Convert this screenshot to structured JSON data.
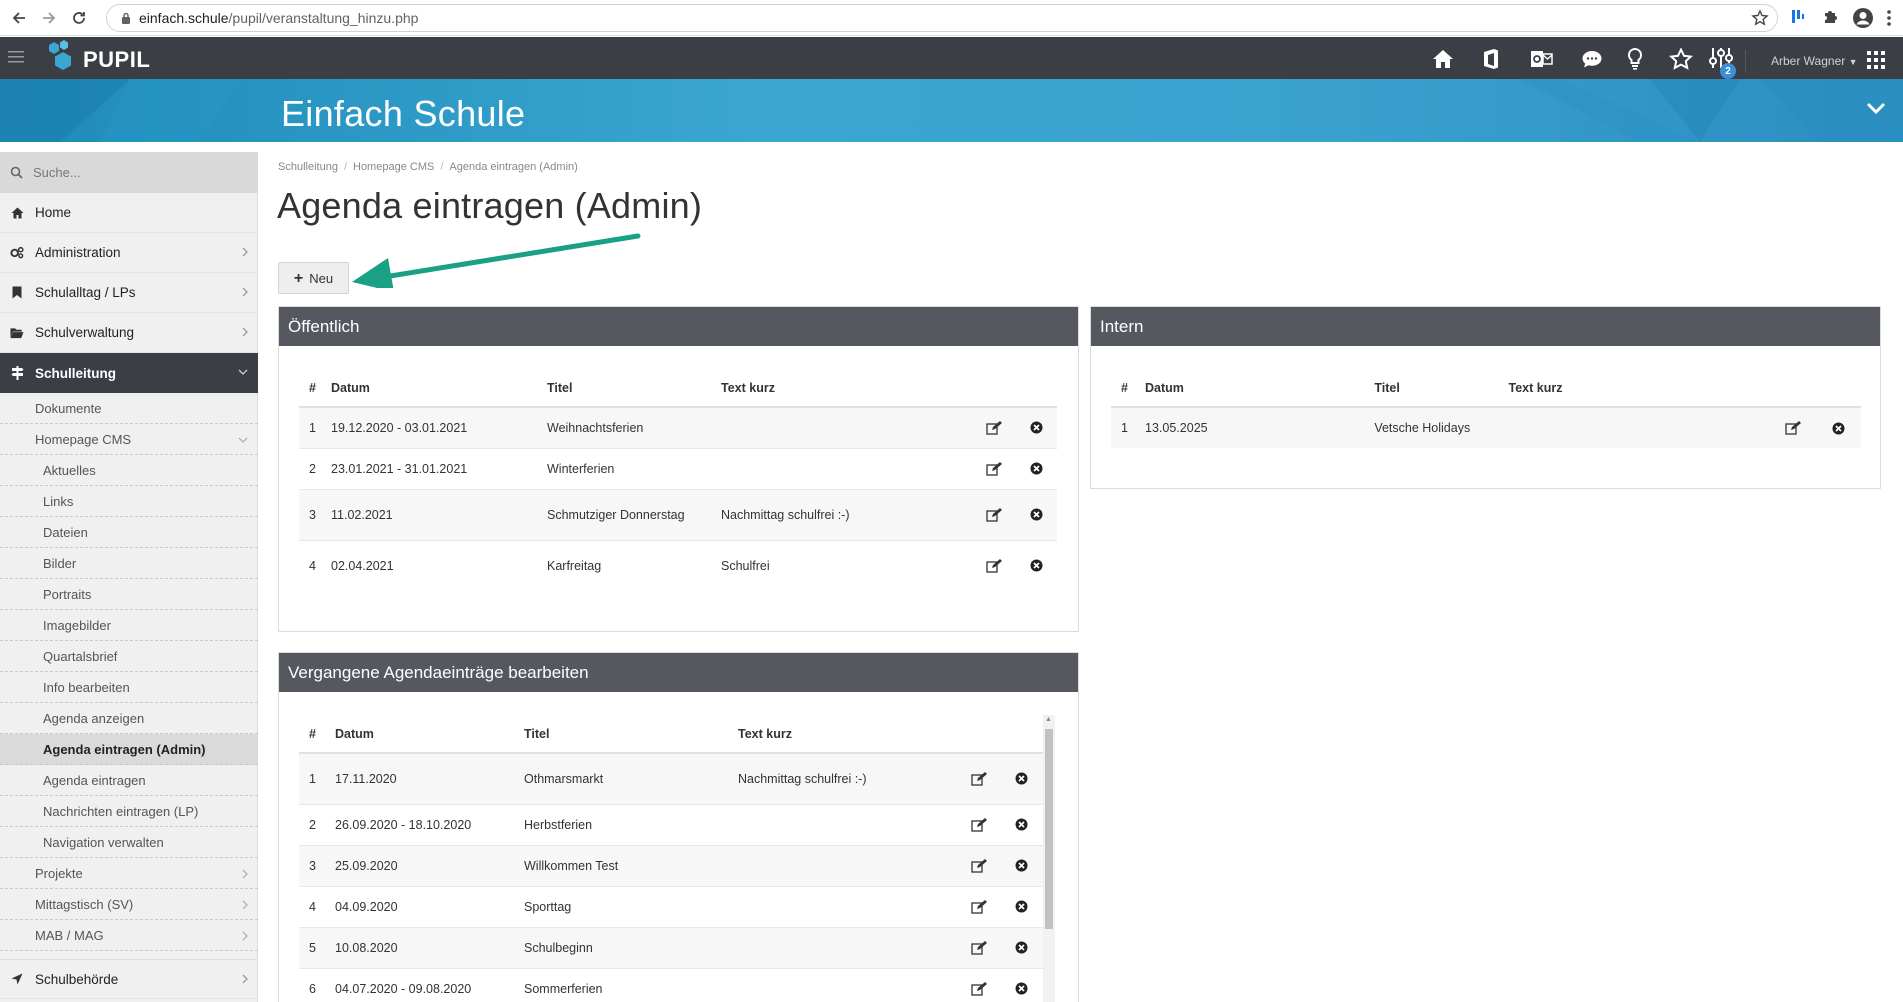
{
  "browser": {
    "url_host": "einfach.schule",
    "url_path": "/pupil/veranstaltung_hinzu.php"
  },
  "app": {
    "logo_text": "PUPIL",
    "school_name": "Einfach Schule",
    "user_name": "Arber Wagner",
    "notification_count": "2"
  },
  "sidebar": {
    "search_placeholder": "Suche...",
    "main_items": [
      {
        "label": "Home",
        "icon": "home-icon"
      },
      {
        "label": "Administration",
        "icon": "gears-icon"
      },
      {
        "label": "Schulalltag / LPs",
        "icon": "bookmark-icon"
      },
      {
        "label": "Schulverwaltung",
        "icon": "folder-open-icon"
      },
      {
        "label": "Schulleitung",
        "icon": "signpost-icon"
      }
    ],
    "sub_items": [
      {
        "label": "Dokumente"
      },
      {
        "label": "Homepage CMS"
      },
      {
        "label": "Aktuelles"
      },
      {
        "label": "Links"
      },
      {
        "label": "Dateien"
      },
      {
        "label": "Bilder"
      },
      {
        "label": "Portraits"
      },
      {
        "label": "Imagebilder"
      },
      {
        "label": "Quartalsbrief"
      },
      {
        "label": "Info bearbeiten"
      },
      {
        "label": "Agenda anzeigen"
      },
      {
        "label": "Agenda eintragen (Admin)"
      },
      {
        "label": "Agenda eintragen"
      },
      {
        "label": "Nachrichten eintragen (LP)"
      },
      {
        "label": "Navigation verwalten"
      },
      {
        "label": "Projekte"
      },
      {
        "label": "Mittagstisch (SV)"
      },
      {
        "label": "MAB / MAG"
      }
    ],
    "last_item": {
      "label": "Schulbehörde",
      "icon": "location-arrow-icon"
    }
  },
  "breadcrumb": [
    "Schulleitung",
    "Homepage CMS",
    "Agenda eintragen (Admin)"
  ],
  "page_title": "Agenda eintragen (Admin)",
  "new_button_label": "Neu",
  "columns": {
    "num": "#",
    "date": "Datum",
    "title": "Titel",
    "text": "Text kurz"
  },
  "public_panel": {
    "title": "Öffentlich",
    "rows": [
      {
        "num": "1",
        "date": "19.12.2020 - 03.01.2021",
        "title": "Weihnachtsferien",
        "text": ""
      },
      {
        "num": "2",
        "date": "23.01.2021 - 31.01.2021",
        "title": "Winterferien",
        "text": ""
      },
      {
        "num": "3",
        "date": "11.02.2021",
        "title": "Schmutziger Donnerstag",
        "text": "Nachmittag schulfrei :-)"
      },
      {
        "num": "4",
        "date": "02.04.2021",
        "title": "Karfreitag",
        "text": "Schulfrei"
      }
    ]
  },
  "intern_panel": {
    "title": "Intern",
    "rows": [
      {
        "num": "1",
        "date": "13.05.2025",
        "title": "Vetsche Holidays",
        "text": ""
      }
    ]
  },
  "past_panel": {
    "title": "Vergangene Agendaeinträge bearbeiten",
    "rows": [
      {
        "num": "1",
        "date": "17.11.2020",
        "title": "Othmarsmarkt",
        "text": "Nachmittag schulfrei :-)"
      },
      {
        "num": "2",
        "date": "26.09.2020 - 18.10.2020",
        "title": "Herbstferien",
        "text": ""
      },
      {
        "num": "3",
        "date": "25.09.2020",
        "title": "Willkommen Test",
        "text": ""
      },
      {
        "num": "4",
        "date": "04.09.2020",
        "title": "Sporttag",
        "text": ""
      },
      {
        "num": "5",
        "date": "10.08.2020",
        "title": "Schulbeginn",
        "text": ""
      },
      {
        "num": "6",
        "date": "04.07.2020 - 09.08.2020",
        "title": "Sommerferien",
        "text": ""
      }
    ]
  },
  "colors": {
    "topbar": "#3b3e45",
    "banner": "#3aa6d1",
    "panel_header": "#55585f",
    "arrow": "#1aa085"
  }
}
